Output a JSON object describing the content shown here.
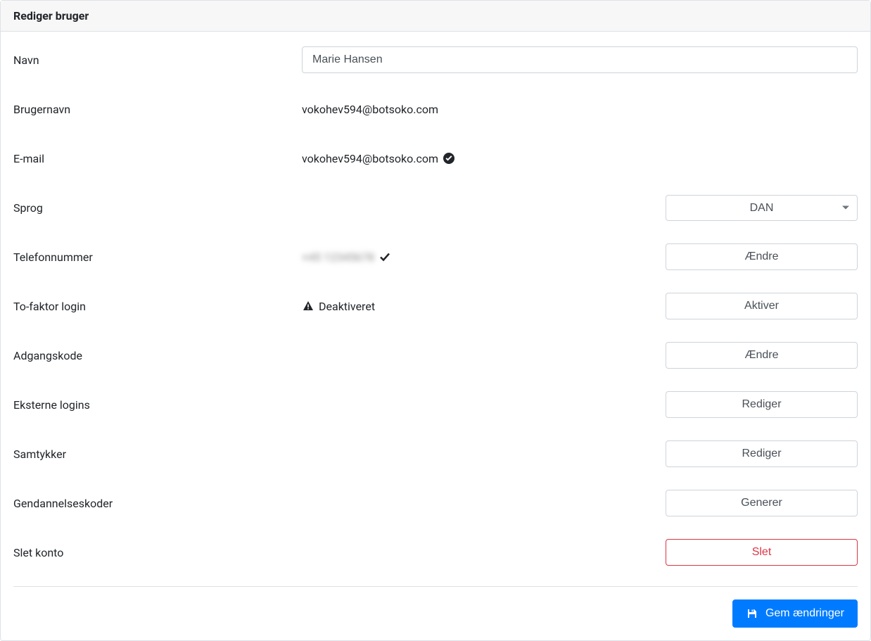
{
  "header": {
    "title": "Rediger bruger"
  },
  "fields": {
    "name": {
      "label": "Navn",
      "value": "Marie Hansen"
    },
    "username": {
      "label": "Brugernavn",
      "value": "vokohev594@botsoko.com"
    },
    "email": {
      "label": "E-mail",
      "value": "vokohev594@botsoko.com"
    },
    "language": {
      "label": "Sprog",
      "selected": "DAN"
    },
    "phone": {
      "label": "Telefonnummer",
      "value_masked": "+45 12345678",
      "action": "Ændre"
    },
    "twofactor": {
      "label": "To-faktor login",
      "status": "Deaktiveret",
      "action": "Aktiver"
    },
    "password": {
      "label": "Adgangskode",
      "action": "Ændre"
    },
    "external_logins": {
      "label": "Eksterne logins",
      "action": "Rediger"
    },
    "consents": {
      "label": "Samtykker",
      "action": "Rediger"
    },
    "recovery_codes": {
      "label": "Gendannelseskoder",
      "action": "Generer"
    },
    "delete_account": {
      "label": "Slet konto",
      "action": "Slet"
    }
  },
  "footer": {
    "save": "Gem ændringer"
  }
}
